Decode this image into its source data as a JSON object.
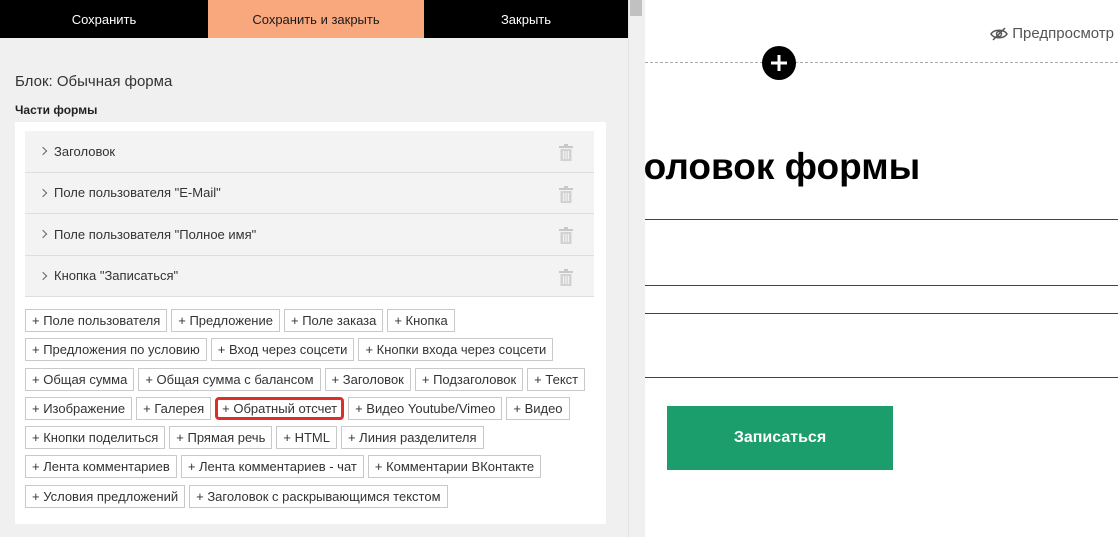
{
  "toolbar": {
    "save_label": "Сохранить",
    "save_close_label": "Сохранить и закрыть",
    "close_label": "Закрыть",
    "save_close_color": "#f9a87e"
  },
  "editor": {
    "block_title": "Блок: Обычная форма",
    "parts_title": "Части формы",
    "parts": [
      {
        "label": "Заголовок",
        "icon": "trash-icon"
      },
      {
        "label": "Поле пользователя \"E-Mail\"",
        "icon": "trash-icon"
      },
      {
        "label": "Поле пользователя \"Полное имя\"",
        "icon": "trash-icon"
      },
      {
        "label": "Кнопка \"Записаться\"",
        "icon": "trash-icon"
      }
    ],
    "add_buttons": [
      [
        "+ Поле пользователя",
        "+ Предложение",
        "+ Поле заказа",
        "+ Кнопка"
      ],
      [
        "+ Предложения по условию",
        "+ Вход через соцсети",
        "+ Кнопки входа через соцсети"
      ],
      [
        "+ Общая сумма",
        "+ Общая сумма с балансом",
        "+ Заголовок",
        "+ Подзаголовок",
        "+ Текст"
      ],
      [
        "+ Изображение",
        "+ Галерея",
        "+ Обратный отсчет",
        "+ Видео Youtube/Vimeo",
        "+ Видео"
      ],
      [
        "+ Кнопки поделиться",
        "+ Прямая речь",
        "+ HTML",
        "+ Линия разделителя"
      ],
      [
        "+ Лента комментариев",
        "+ Лента комментариев - чат",
        "+ Комментарии ВКонтакте"
      ],
      [
        "+ Условия предложений",
        "+ Заголовок с раскрывающимся текстом"
      ]
    ],
    "highlighted_button": "+ Обратный отсчет",
    "highlight_color": "#d9302c"
  },
  "preview": {
    "preview_label": "Предпросмотр",
    "form_title": "Заголовок формы",
    "submit_label": "Записаться",
    "submit_color": "#1b9e6b"
  }
}
